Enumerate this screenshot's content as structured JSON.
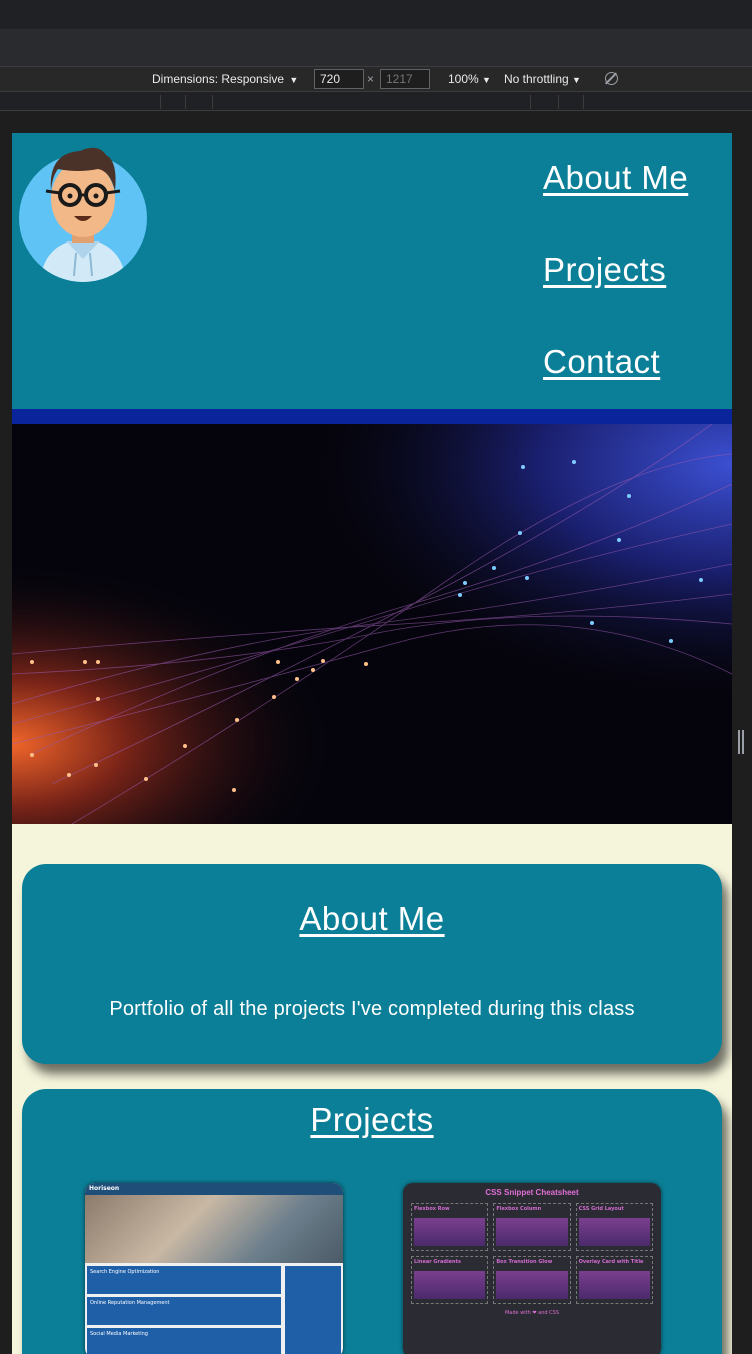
{
  "devtools": {
    "dimensions_label": "Dimensions: Responsive",
    "width_value": "720",
    "times": "×",
    "height_placeholder": "1217",
    "zoom": "100%",
    "throttling": "No throttling"
  },
  "nav": {
    "items": [
      {
        "label": "About Me"
      },
      {
        "label": "Projects"
      },
      {
        "label": "Contact"
      }
    ]
  },
  "about": {
    "title": "About Me",
    "text": "Portfolio of all the projects I've completed during this class"
  },
  "projects": {
    "title": "Projects",
    "items": [
      {
        "brand": "Horiseon",
        "rows": [
          "Search Engine Optimization",
          "Online Reputation Management",
          "Social Media Marketing"
        ]
      },
      {
        "title": "CSS Snippet Cheatsheet",
        "cells": [
          "Flexbox Row",
          "Flexbox Column",
          "CSS Grid Layout",
          "Linear Gradients",
          "Box Transition Glow",
          "Overlay Card with Title"
        ],
        "footer": "Made with ❤ and CSS"
      }
    ]
  },
  "colors": {
    "header_bg": "#0b7f97",
    "stripe": "#0a259c",
    "page_bg": "#f5f5dc",
    "card_bg": "#0b7f97"
  }
}
